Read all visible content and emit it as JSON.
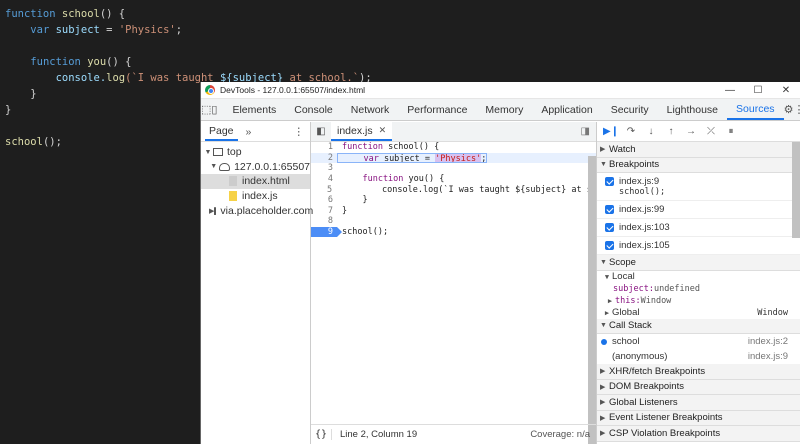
{
  "background_code": {
    "l1_kw": "function",
    "l1_name": "school",
    "l1_rest": "() {",
    "l2_kw": "var",
    "l2_var": "subject",
    "l2_eq": " = ",
    "l2_str": "'Physics'",
    "l2_end": ";",
    "l4_kw": "function",
    "l4_name": "you",
    "l4_rest": "() {",
    "l5_pre": "console.",
    "l5_fn": "log",
    "l5_str1": "(`I was taught ",
    "l5_tpl": "${subject}",
    "l5_str2": " at school.`",
    "l5_end": ");",
    "l6": "}",
    "l7": "}",
    "l9_name": "school",
    "l9_rest": "();"
  },
  "window": {
    "title": "DevTools - 127.0.0.1:65507/index.html",
    "minimize": "—",
    "maximize": "☐",
    "close": "✕"
  },
  "tabs": [
    "Elements",
    "Console",
    "Network",
    "Performance",
    "Memory",
    "Application",
    "Security",
    "Lighthouse",
    "Sources"
  ],
  "active_tab": "Sources",
  "navigator": {
    "page_tab": "Page",
    "more": "»",
    "tree": {
      "top": "top",
      "host": "127.0.0.1:65507",
      "file1": "index.html",
      "file2": "index.js",
      "other": "via.placeholder.com"
    }
  },
  "editor": {
    "file_tab": "index.js",
    "lines": [
      {
        "n": "1",
        "a": "function",
        "b": " school() {"
      },
      {
        "n": "2",
        "a": "    var",
        "b": " subject = ",
        "c": "'Physics'",
        "d": ";"
      },
      {
        "n": "3",
        "a": "",
        "b": ""
      },
      {
        "n": "4",
        "a": "    function",
        "b": " you() {"
      },
      {
        "n": "5",
        "a": "",
        "b": "        console.log(`I was taught ${subject} at scho"
      },
      {
        "n": "6",
        "a": "",
        "b": "    }"
      },
      {
        "n": "7",
        "a": "",
        "b": "}"
      },
      {
        "n": "8",
        "a": "",
        "b": ""
      },
      {
        "n": "9",
        "a": "",
        "b": "school();"
      }
    ],
    "status_braces": "{}",
    "status_position": "Line 2, Column 19",
    "coverage": "Coverage: n/a"
  },
  "debugger": {
    "sections": {
      "watch": "Watch",
      "breakpoints": "Breakpoints",
      "scope": "Scope",
      "call_stack": "Call Stack",
      "xhr": "XHR/fetch Breakpoints",
      "dom": "DOM Breakpoints",
      "global_listeners": "Global Listeners",
      "event_listeners": "Event Listener Breakpoints",
      "csp": "CSP Violation Breakpoints"
    },
    "breakpoints": [
      {
        "loc": "index.js:9",
        "code": "school();"
      },
      {
        "loc": "index.js:99",
        "code": ""
      },
      {
        "loc": "index.js:103",
        "code": ""
      },
      {
        "loc": "index.js:105",
        "code": ""
      }
    ],
    "scope": {
      "local": "Local",
      "subject_key": "subject:",
      "subject_val": " undefined",
      "this_key": "this:",
      "this_val": " Window",
      "global": "Global",
      "global_val": "Window"
    },
    "call_stack": [
      {
        "fn": "school",
        "loc": "index.js:2"
      },
      {
        "fn": "(anonymous)",
        "loc": "index.js:9"
      }
    ]
  }
}
